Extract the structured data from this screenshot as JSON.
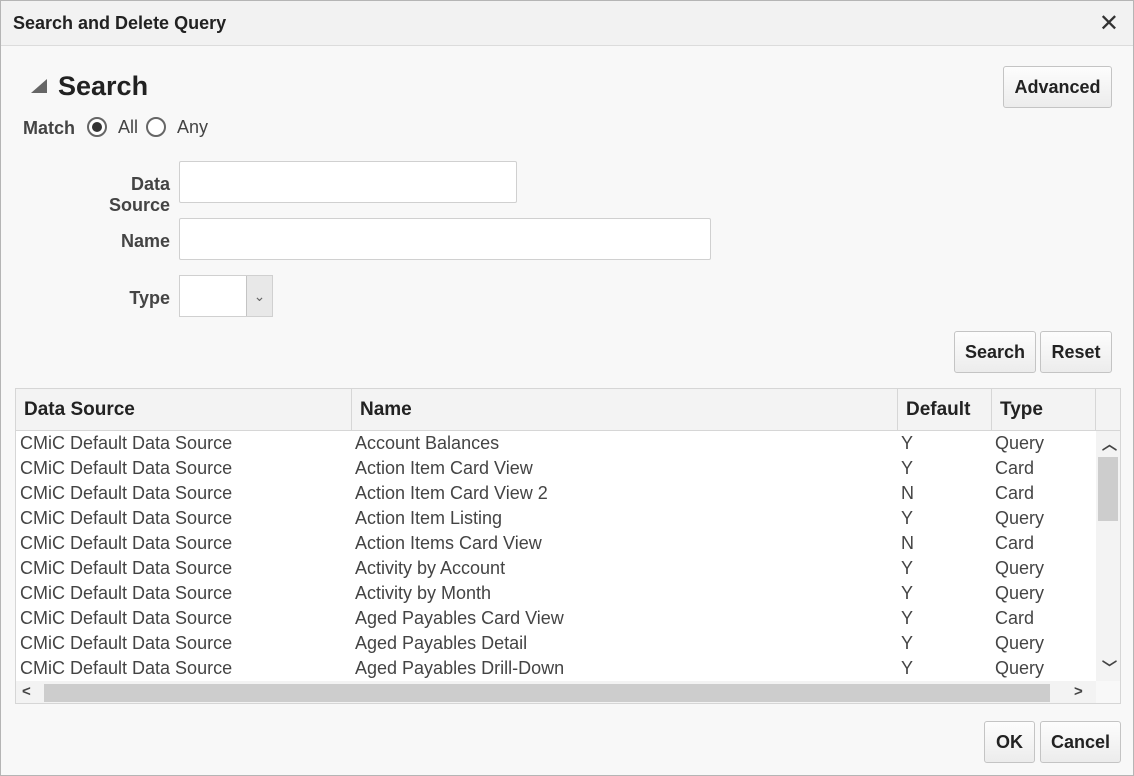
{
  "dialog": {
    "title": "Search and Delete Query",
    "close_icon": "✕"
  },
  "search": {
    "heading": "Search",
    "advanced_label": "Advanced",
    "match_label": "Match",
    "match_all": "All",
    "match_any": "Any",
    "selected_match": "All",
    "data_source_label": "Data Source",
    "data_source_value": "",
    "name_label": "Name",
    "name_value": "",
    "type_label": "Type",
    "type_value": "",
    "search_button": "Search",
    "reset_button": "Reset"
  },
  "table": {
    "columns": [
      "Data Source",
      "Name",
      "Default",
      "Type"
    ],
    "rows": [
      [
        "CMiC Default Data Source",
        "Account Balances",
        "Y",
        "Query"
      ],
      [
        "CMiC Default Data Source",
        "Action Item Card View",
        "Y",
        "Card"
      ],
      [
        "CMiC Default Data Source",
        "Action Item Card View 2",
        "N",
        "Card"
      ],
      [
        "CMiC Default Data Source",
        "Action Item Listing",
        "Y",
        "Query"
      ],
      [
        "CMiC Default Data Source",
        "Action Items Card View",
        "N",
        "Card"
      ],
      [
        "CMiC Default Data Source",
        "Activity by Account",
        "Y",
        "Query"
      ],
      [
        "CMiC Default Data Source",
        "Activity by Month",
        "Y",
        "Query"
      ],
      [
        "CMiC Default Data Source",
        "Aged Payables Card View",
        "Y",
        "Card"
      ],
      [
        "CMiC Default Data Source",
        "Aged Payables Detail",
        "Y",
        "Query"
      ],
      [
        "CMiC Default Data Source",
        "Aged Payables Drill-Down",
        "Y",
        "Query"
      ]
    ]
  },
  "footer": {
    "ok_label": "OK",
    "cancel_label": "Cancel"
  }
}
